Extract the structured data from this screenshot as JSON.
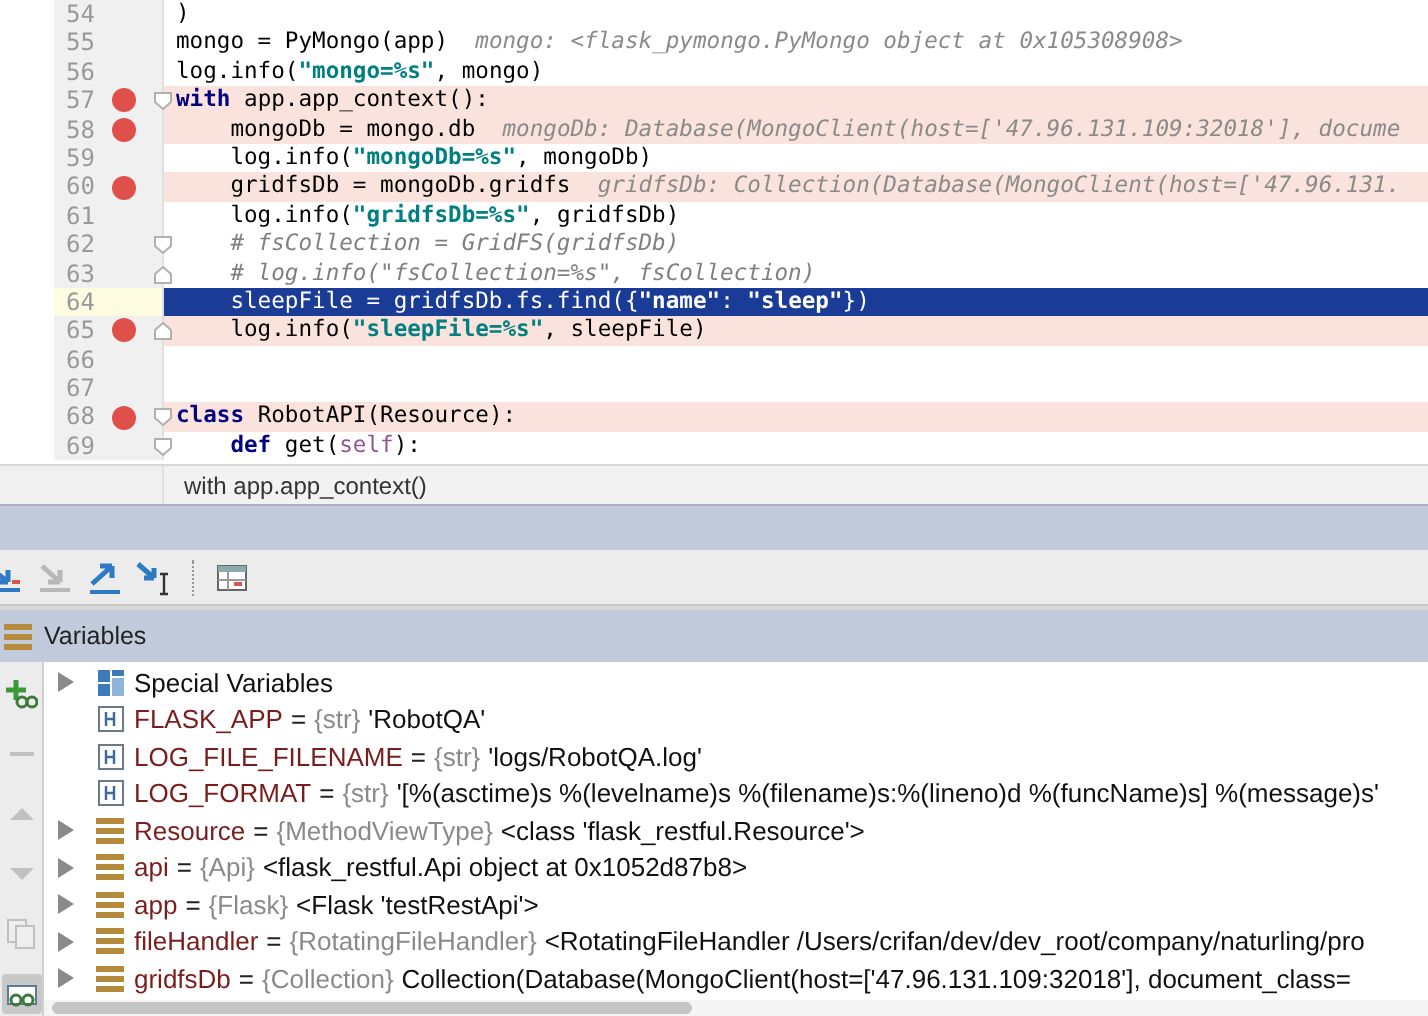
{
  "editor": {
    "lines": [
      {
        "number": "54",
        "breakpoint": false,
        "current": false,
        "segments": [
          {
            "kind": "code",
            "text": ")"
          }
        ]
      },
      {
        "number": "55",
        "breakpoint": false,
        "current": false,
        "segments": [
          {
            "kind": "code",
            "text": "mongo = PyMongo(app)  "
          },
          {
            "kind": "hint",
            "text": "mongo: <flask_pymongo.PyMongo object at 0x105308908>"
          }
        ]
      },
      {
        "number": "56",
        "breakpoint": false,
        "current": false,
        "segments": [
          {
            "kind": "code",
            "text": "log.info("
          },
          {
            "kind": "string",
            "text": "\"mongo=%s\""
          },
          {
            "kind": "code",
            "text": ", mongo)"
          }
        ]
      },
      {
        "number": "57",
        "breakpoint": true,
        "current": false,
        "fold": {
          "kind": "start"
        },
        "segments": [
          {
            "kind": "keyword",
            "text": "with"
          },
          {
            "kind": "code",
            "text": " app.app_context():"
          }
        ]
      },
      {
        "number": "58",
        "breakpoint": true,
        "current": false,
        "segments": [
          {
            "kind": "code",
            "text": "    mongoDb = mongo.db  "
          },
          {
            "kind": "hint",
            "text": "mongoDb: Database(MongoClient(host=['47.96.131.109:32018'], docume"
          }
        ]
      },
      {
        "number": "59",
        "breakpoint": false,
        "current": false,
        "segments": [
          {
            "kind": "code",
            "text": "    log.info("
          },
          {
            "kind": "string",
            "text": "\"mongoDb=%s\""
          },
          {
            "kind": "code",
            "text": ", mongoDb)"
          }
        ]
      },
      {
        "number": "60",
        "breakpoint": true,
        "current": false,
        "segments": [
          {
            "kind": "code",
            "text": "    gridfsDb = mongoDb.gridfs  "
          },
          {
            "kind": "hint",
            "text": "gridfsDb: Collection(Database(MongoClient(host=['47.96.131."
          }
        ]
      },
      {
        "number": "61",
        "breakpoint": false,
        "current": false,
        "segments": [
          {
            "kind": "code",
            "text": "    log.info("
          },
          {
            "kind": "string",
            "text": "\"gridfsDb=%s\""
          },
          {
            "kind": "code",
            "text": ", gridfsDb)"
          }
        ]
      },
      {
        "number": "62",
        "breakpoint": false,
        "current": false,
        "fold": {
          "kind": "start"
        },
        "segments": [
          {
            "kind": "comment",
            "text": "    # fsCollection = GridFS(gridfsDb)"
          }
        ]
      },
      {
        "number": "63",
        "breakpoint": false,
        "current": false,
        "fold": {
          "kind": "end"
        },
        "segments": [
          {
            "kind": "comment",
            "text": "    # log.info(\"fsCollection=%s\", fsCollection)"
          }
        ]
      },
      {
        "number": "64",
        "breakpoint": false,
        "current": true,
        "segments": [
          {
            "kind": "code",
            "text": "    sleepFile = gridfsDb.fs.find({"
          },
          {
            "kind": "string",
            "text": "\"name\""
          },
          {
            "kind": "code",
            "text": ": "
          },
          {
            "kind": "string",
            "text": "\"sleep\""
          },
          {
            "kind": "code",
            "text": "})"
          }
        ]
      },
      {
        "number": "65",
        "breakpoint": true,
        "current": false,
        "fold": {
          "kind": "end"
        },
        "segments": [
          {
            "kind": "code",
            "text": "    log.info("
          },
          {
            "kind": "string",
            "text": "\"sleepFile=%s\""
          },
          {
            "kind": "code",
            "text": ", sleepFile)"
          }
        ]
      },
      {
        "number": "66",
        "breakpoint": false,
        "current": false
      },
      {
        "number": "67",
        "breakpoint": false,
        "current": false
      },
      {
        "number": "68",
        "breakpoint": true,
        "current": false,
        "fold": {
          "kind": "start"
        },
        "segments": [
          {
            "kind": "keyword",
            "text": "class"
          },
          {
            "kind": "code",
            "text": " RobotAPI(Resource):"
          }
        ]
      },
      {
        "number": "69",
        "breakpoint": false,
        "current": false,
        "fold": {
          "kind": "start"
        },
        "segments": [
          {
            "kind": "keyword",
            "text": "    def"
          },
          {
            "kind": "code",
            "text": " get("
          },
          {
            "kind": "self",
            "text": "self"
          },
          {
            "kind": "code",
            "text": "):"
          }
        ]
      }
    ],
    "breadcrumb": "with app.app_context()"
  },
  "debugger": {
    "toolbar": [
      {
        "kind": "step-into"
      },
      {
        "kind": "step-into-disabled"
      },
      {
        "kind": "step-out"
      },
      {
        "kind": "run-to-cursor"
      },
      {
        "kind": "evaluate"
      }
    ],
    "panel_title": "Variables",
    "side_tools": [
      {
        "kind": "add-watch",
        "selected": false
      },
      {
        "kind": "remove",
        "selected": false
      },
      {
        "kind": "up",
        "selected": false
      },
      {
        "kind": "down",
        "selected": false
      },
      {
        "kind": "copy",
        "selected": false
      },
      {
        "kind": "glasses",
        "selected": true
      }
    ],
    "variables": [
      {
        "expandable": true,
        "kind": "special",
        "name": "Special Variables"
      },
      {
        "expandable": false,
        "kind": "field",
        "name": "FLASK_APP",
        "operator": "=",
        "type": "{str}",
        "value": "'RobotQA'"
      },
      {
        "expandable": false,
        "kind": "field",
        "name": "LOG_FILE_FILENAME",
        "operator": "=",
        "type": "{str}",
        "value": "'logs/RobotQA.log'"
      },
      {
        "expandable": false,
        "kind": "field",
        "name": "LOG_FORMAT",
        "operator": "=",
        "type": "{str}",
        "value": "'[%(asctime)s %(levelname)s %(filename)s:%(lineno)d %(funcName)s] %(message)s'"
      },
      {
        "expandable": true,
        "kind": "object",
        "name": "Resource",
        "operator": "=",
        "type": "{MethodViewType}",
        "value": "<class 'flask_restful.Resource'>"
      },
      {
        "expandable": true,
        "kind": "object",
        "name": "api",
        "operator": "=",
        "type": "{Api}",
        "value": "<flask_restful.Api object at 0x1052d87b8>"
      },
      {
        "expandable": true,
        "kind": "object",
        "name": "app",
        "operator": "=",
        "type": "{Flask}",
        "value": "<Flask 'testRestApi'>"
      },
      {
        "expandable": true,
        "kind": "object",
        "name": "fileHandler",
        "operator": "=",
        "type": "{RotatingFileHandler}",
        "value": "<RotatingFileHandler /Users/crifan/dev/dev_root/company/naturling/pro"
      },
      {
        "expandable": true,
        "kind": "object",
        "name": "gridfsDb",
        "operator": "=",
        "type": "{Collection}",
        "value": "Collection(Database(MongoClient(host=['47.96.131.109:32018'], document_class="
      }
    ]
  }
}
